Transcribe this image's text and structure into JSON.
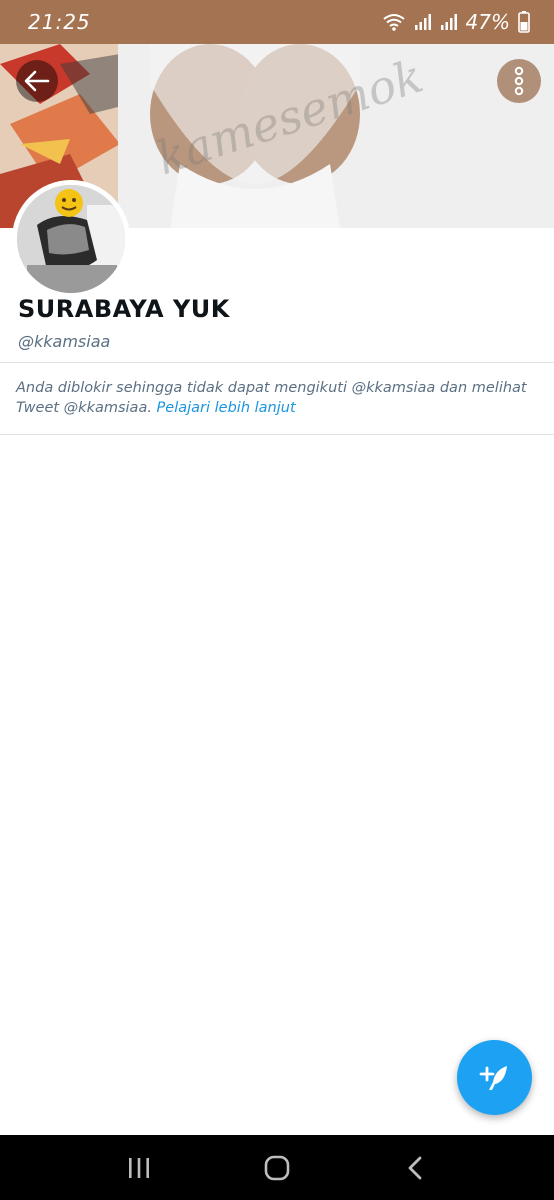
{
  "status_bar": {
    "time": "21:25",
    "battery": "47%",
    "icons": [
      "wifi-icon",
      "signal-icon",
      "signal-icon",
      "battery-icon"
    ]
  },
  "header": {
    "watermark": "kamesemok",
    "back_icon": "arrow-left-icon",
    "more_icon": "more-vertical-icon"
  },
  "profile": {
    "name": "SURABAYA YUK",
    "handle": "@kkamsiaa"
  },
  "blocked_notice": {
    "text": "Anda diblokir sehingga tidak dapat mengikuti @kkamsiaa dan melihat Tweet @kkamsiaa.",
    "link": "Pelajari lebih lanjut"
  },
  "fab": {
    "icon": "compose-tweet-icon"
  },
  "nav": {
    "recents_icon": "recents-icon",
    "home_icon": "home-icon",
    "back_icon": "chevron-left-icon"
  },
  "colors": {
    "status_bar": "#a47452",
    "accent": "#1da1f2",
    "link": "#1b95e0",
    "secondary_text": "#5b7083"
  }
}
